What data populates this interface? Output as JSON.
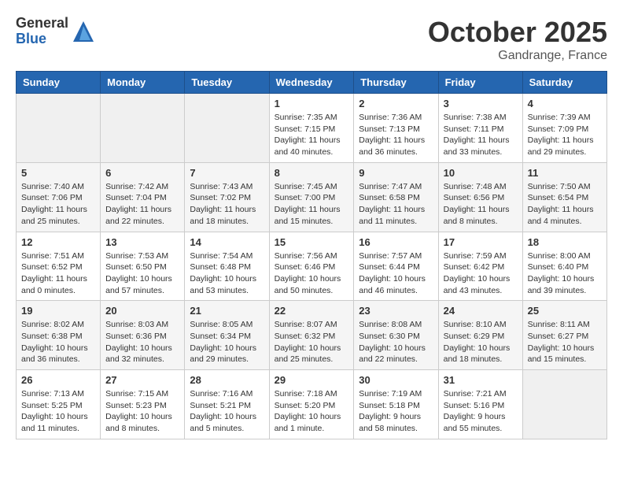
{
  "logo": {
    "general": "General",
    "blue": "Blue"
  },
  "header": {
    "month": "October 2025",
    "location": "Gandrange, France"
  },
  "weekdays": [
    "Sunday",
    "Monday",
    "Tuesday",
    "Wednesday",
    "Thursday",
    "Friday",
    "Saturday"
  ],
  "weeks": [
    [
      {
        "day": "",
        "sunrise": "",
        "sunset": "",
        "daylight": ""
      },
      {
        "day": "",
        "sunrise": "",
        "sunset": "",
        "daylight": ""
      },
      {
        "day": "",
        "sunrise": "",
        "sunset": "",
        "daylight": ""
      },
      {
        "day": "1",
        "sunrise": "Sunrise: 7:35 AM",
        "sunset": "Sunset: 7:15 PM",
        "daylight": "Daylight: 11 hours and 40 minutes."
      },
      {
        "day": "2",
        "sunrise": "Sunrise: 7:36 AM",
        "sunset": "Sunset: 7:13 PM",
        "daylight": "Daylight: 11 hours and 36 minutes."
      },
      {
        "day": "3",
        "sunrise": "Sunrise: 7:38 AM",
        "sunset": "Sunset: 7:11 PM",
        "daylight": "Daylight: 11 hours and 33 minutes."
      },
      {
        "day": "4",
        "sunrise": "Sunrise: 7:39 AM",
        "sunset": "Sunset: 7:09 PM",
        "daylight": "Daylight: 11 hours and 29 minutes."
      }
    ],
    [
      {
        "day": "5",
        "sunrise": "Sunrise: 7:40 AM",
        "sunset": "Sunset: 7:06 PM",
        "daylight": "Daylight: 11 hours and 25 minutes."
      },
      {
        "day": "6",
        "sunrise": "Sunrise: 7:42 AM",
        "sunset": "Sunset: 7:04 PM",
        "daylight": "Daylight: 11 hours and 22 minutes."
      },
      {
        "day": "7",
        "sunrise": "Sunrise: 7:43 AM",
        "sunset": "Sunset: 7:02 PM",
        "daylight": "Daylight: 11 hours and 18 minutes."
      },
      {
        "day": "8",
        "sunrise": "Sunrise: 7:45 AM",
        "sunset": "Sunset: 7:00 PM",
        "daylight": "Daylight: 11 hours and 15 minutes."
      },
      {
        "day": "9",
        "sunrise": "Sunrise: 7:47 AM",
        "sunset": "Sunset: 6:58 PM",
        "daylight": "Daylight: 11 hours and 11 minutes."
      },
      {
        "day": "10",
        "sunrise": "Sunrise: 7:48 AM",
        "sunset": "Sunset: 6:56 PM",
        "daylight": "Daylight: 11 hours and 8 minutes."
      },
      {
        "day": "11",
        "sunrise": "Sunrise: 7:50 AM",
        "sunset": "Sunset: 6:54 PM",
        "daylight": "Daylight: 11 hours and 4 minutes."
      }
    ],
    [
      {
        "day": "12",
        "sunrise": "Sunrise: 7:51 AM",
        "sunset": "Sunset: 6:52 PM",
        "daylight": "Daylight: 11 hours and 0 minutes."
      },
      {
        "day": "13",
        "sunrise": "Sunrise: 7:53 AM",
        "sunset": "Sunset: 6:50 PM",
        "daylight": "Daylight: 10 hours and 57 minutes."
      },
      {
        "day": "14",
        "sunrise": "Sunrise: 7:54 AM",
        "sunset": "Sunset: 6:48 PM",
        "daylight": "Daylight: 10 hours and 53 minutes."
      },
      {
        "day": "15",
        "sunrise": "Sunrise: 7:56 AM",
        "sunset": "Sunset: 6:46 PM",
        "daylight": "Daylight: 10 hours and 50 minutes."
      },
      {
        "day": "16",
        "sunrise": "Sunrise: 7:57 AM",
        "sunset": "Sunset: 6:44 PM",
        "daylight": "Daylight: 10 hours and 46 minutes."
      },
      {
        "day": "17",
        "sunrise": "Sunrise: 7:59 AM",
        "sunset": "Sunset: 6:42 PM",
        "daylight": "Daylight: 10 hours and 43 minutes."
      },
      {
        "day": "18",
        "sunrise": "Sunrise: 8:00 AM",
        "sunset": "Sunset: 6:40 PM",
        "daylight": "Daylight: 10 hours and 39 minutes."
      }
    ],
    [
      {
        "day": "19",
        "sunrise": "Sunrise: 8:02 AM",
        "sunset": "Sunset: 6:38 PM",
        "daylight": "Daylight: 10 hours and 36 minutes."
      },
      {
        "day": "20",
        "sunrise": "Sunrise: 8:03 AM",
        "sunset": "Sunset: 6:36 PM",
        "daylight": "Daylight: 10 hours and 32 minutes."
      },
      {
        "day": "21",
        "sunrise": "Sunrise: 8:05 AM",
        "sunset": "Sunset: 6:34 PM",
        "daylight": "Daylight: 10 hours and 29 minutes."
      },
      {
        "day": "22",
        "sunrise": "Sunrise: 8:07 AM",
        "sunset": "Sunset: 6:32 PM",
        "daylight": "Daylight: 10 hours and 25 minutes."
      },
      {
        "day": "23",
        "sunrise": "Sunrise: 8:08 AM",
        "sunset": "Sunset: 6:30 PM",
        "daylight": "Daylight: 10 hours and 22 minutes."
      },
      {
        "day": "24",
        "sunrise": "Sunrise: 8:10 AM",
        "sunset": "Sunset: 6:29 PM",
        "daylight": "Daylight: 10 hours and 18 minutes."
      },
      {
        "day": "25",
        "sunrise": "Sunrise: 8:11 AM",
        "sunset": "Sunset: 6:27 PM",
        "daylight": "Daylight: 10 hours and 15 minutes."
      }
    ],
    [
      {
        "day": "26",
        "sunrise": "Sunrise: 7:13 AM",
        "sunset": "Sunset: 5:25 PM",
        "daylight": "Daylight: 10 hours and 11 minutes."
      },
      {
        "day": "27",
        "sunrise": "Sunrise: 7:15 AM",
        "sunset": "Sunset: 5:23 PM",
        "daylight": "Daylight: 10 hours and 8 minutes."
      },
      {
        "day": "28",
        "sunrise": "Sunrise: 7:16 AM",
        "sunset": "Sunset: 5:21 PM",
        "daylight": "Daylight: 10 hours and 5 minutes."
      },
      {
        "day": "29",
        "sunrise": "Sunrise: 7:18 AM",
        "sunset": "Sunset: 5:20 PM",
        "daylight": "Daylight: 10 hours and 1 minute."
      },
      {
        "day": "30",
        "sunrise": "Sunrise: 7:19 AM",
        "sunset": "Sunset: 5:18 PM",
        "daylight": "Daylight: 9 hours and 58 minutes."
      },
      {
        "day": "31",
        "sunrise": "Sunrise: 7:21 AM",
        "sunset": "Sunset: 5:16 PM",
        "daylight": "Daylight: 9 hours and 55 minutes."
      },
      {
        "day": "",
        "sunrise": "",
        "sunset": "",
        "daylight": ""
      }
    ]
  ]
}
